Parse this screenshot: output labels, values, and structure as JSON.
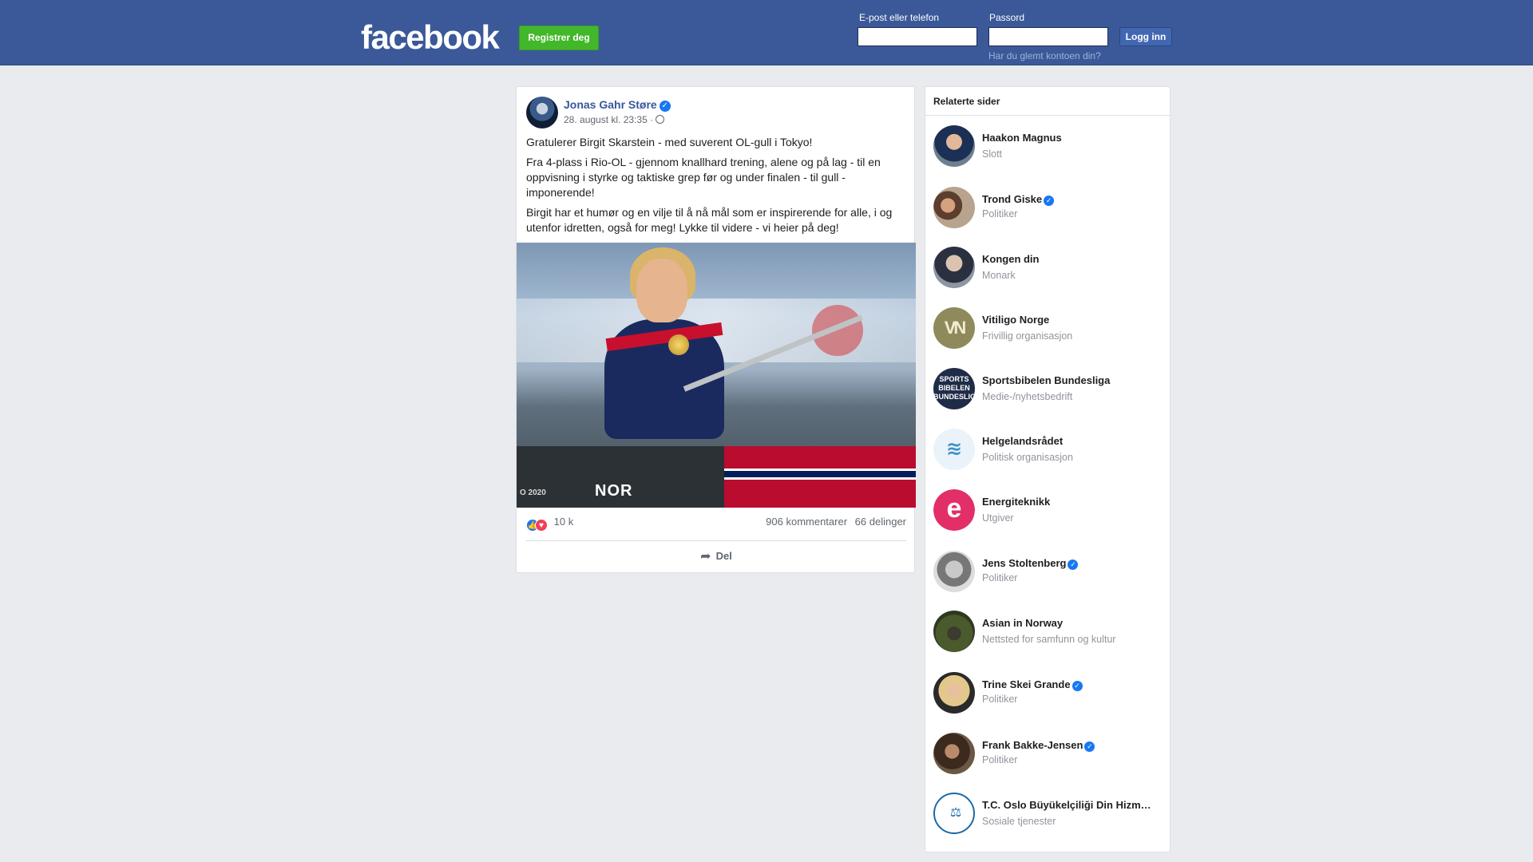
{
  "header": {
    "logo": "facebook",
    "register_label": "Registrer deg",
    "email_label": "E-post eller telefon",
    "password_label": "Passord",
    "email_value": "",
    "password_value": "",
    "login_label": "Logg inn",
    "forgot_label": "Har du glemt kontoen din?"
  },
  "post": {
    "author": "Jonas Gahr Støre",
    "verified_glyph": "✓",
    "timestamp": "28. august kl. 23:35 ·",
    "paragraphs": [
      "Gratulerer Birgit Skarstein - med suverent OL-gull i Tokyo!",
      "Fra 4-plass i Rio-OL - gjennom knallhard trening, alene og på lag - til en oppvisning i styrke og taktiske grep før og under finalen - til gull - imponerende!",
      "Birgit har et humør og en vilje til å nå mål som er inspirerende for alle, i og utenfor idretten, også for meg! Lykke til videre - vi heier på deg!"
    ],
    "photo_text_nor": "NOR",
    "photo_text_year": "O 2020",
    "reaction_count": "10 k",
    "comments": "906 kommentarer",
    "shares": "66 delinger",
    "share_label": "Del"
  },
  "related": {
    "title": "Relaterte sider",
    "pages": [
      {
        "name": "Haakon Magnus",
        "category": "Slott",
        "verified": false
      },
      {
        "name": "Trond Giske",
        "category": "Politiker",
        "verified": true
      },
      {
        "name": "Kongen din",
        "category": "Monark",
        "verified": false
      },
      {
        "name": "Vitiligo Norge",
        "category": "Frivillig organisasjon",
        "verified": false,
        "avatar_text": "VN"
      },
      {
        "name": "Sportsbibelen Bundesliga",
        "category": "Medie-/nyhetsbedrift",
        "verified": false,
        "avatar_text": "SPORTS BIBELEN BUNDESLIGA"
      },
      {
        "name": "Helgelandsrådet",
        "category": "Politisk organisasjon",
        "verified": false
      },
      {
        "name": "Energiteknikk",
        "category": "Utgiver",
        "verified": false,
        "avatar_text": "e"
      },
      {
        "name": "Jens Stoltenberg",
        "category": "Politiker",
        "verified": true
      },
      {
        "name": "Asian in Norway",
        "category": "Nettsted for samfunn og kultur",
        "verified": false
      },
      {
        "name": "Trine Skei Grande",
        "category": "Politiker",
        "verified": true
      },
      {
        "name": "Frank Bakke-Jensen",
        "category": "Politiker",
        "verified": true
      },
      {
        "name": "T.C. Oslo Büyükelçiliği Din Hizm…",
        "category": "Sosiale tjenester",
        "verified": false
      }
    ]
  },
  "colors": {
    "header_bg": "#3b5998",
    "register_green": "#42b72a",
    "link_blue": "#385898",
    "verified_blue": "#1877f2",
    "love_red": "#f33e58"
  },
  "icons": [
    "verified-badge-icon",
    "globe-icon",
    "like-reaction-icon",
    "love-reaction-icon",
    "share-arrow-icon"
  ]
}
